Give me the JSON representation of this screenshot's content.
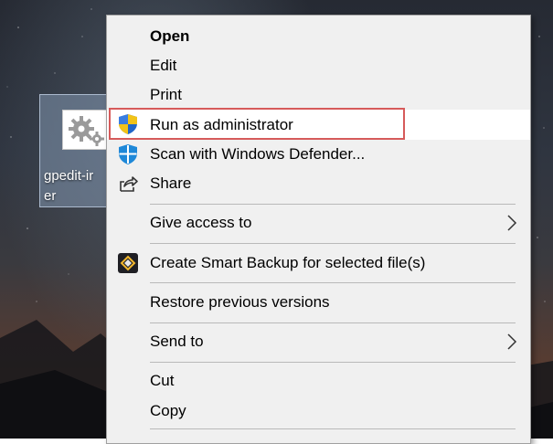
{
  "desktop": {
    "icon": {
      "name": "gpedit-ir\ner",
      "glyph": "gears-icon"
    }
  },
  "context_menu": {
    "items": [
      {
        "label": "Open",
        "bold": true
      },
      {
        "label": "Edit"
      },
      {
        "label": "Print"
      },
      {
        "label": "Run as administrator",
        "icon": "uac-shield-icon",
        "highlighted": true
      },
      {
        "label": "Scan with Windows Defender...",
        "icon": "windows-defender-icon"
      },
      {
        "label": "Share",
        "icon": "share-icon"
      },
      {
        "label": "Give access to",
        "submenu": true
      },
      {
        "label": "Create Smart Backup for selected file(s)",
        "icon": "smart-backup-icon"
      },
      {
        "label": "Restore previous versions"
      },
      {
        "label": "Send to",
        "submenu": true
      },
      {
        "label": "Cut"
      },
      {
        "label": "Copy"
      }
    ]
  },
  "colors": {
    "menu_bg": "#f0f0f0",
    "highlight_bg": "#ffffff",
    "highlight_border": "#d65a5a",
    "separator": "#b9b9b9",
    "defender_blue": "#1e88d8",
    "shield_blue": "#2166c9",
    "shield_yellow": "#f2c318"
  }
}
